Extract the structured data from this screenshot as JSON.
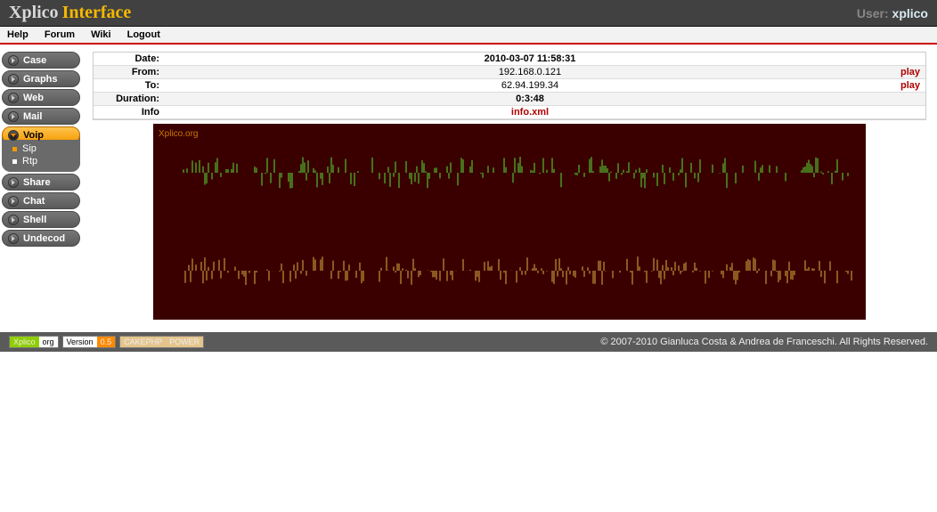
{
  "brand": {
    "part1": "Xplico",
    "part2": "Interface"
  },
  "user": {
    "label": "User:",
    "name": "xplico"
  },
  "nav": {
    "help": "Help",
    "forum": "Forum",
    "wiki": "Wiki",
    "logout": "Logout"
  },
  "sidebar": {
    "case": "Case",
    "graphs": "Graphs",
    "web": "Web",
    "mail": "Mail",
    "voip": "Voip",
    "share": "Share",
    "chat": "Chat",
    "shell": "Shell",
    "undecod": "Undecod",
    "sub": {
      "sip": "Sip",
      "rtp": "Rtp"
    }
  },
  "info": {
    "labels": {
      "date": "Date:",
      "from": "From:",
      "to": "To:",
      "duration": "Duration:",
      "info": "Info"
    },
    "date": "2010-03-07 11:58:31",
    "from": "192.168.0.121",
    "to": "62.94.199.34",
    "duration": "0:3:48",
    "infolink": "info.xml",
    "play": "play"
  },
  "wave": {
    "watermark": "Xplico.org"
  },
  "footer": {
    "copyright": "© 2007-2010 Gianluca Costa & Andrea de Franceschi. All Rights Reserved.",
    "badge_xplico_a": "Xplico",
    "badge_xplico_b": "org",
    "badge_ver_a": "Version",
    "badge_ver_b": "0.5",
    "badge_cake_a": "CAKEPHP",
    "badge_cake_b": "POWER"
  }
}
